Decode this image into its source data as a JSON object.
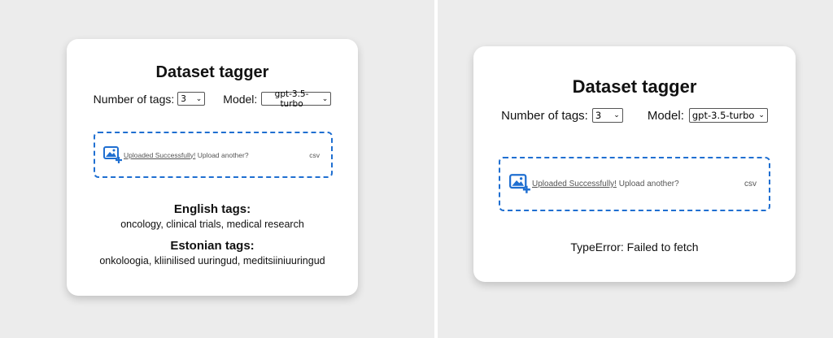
{
  "app": {
    "title": "Dataset tagger",
    "number_of_tags_label": "Number of tags:",
    "number_of_tags_value": "3",
    "model_label": "Model:",
    "model_value": "gpt-3.5-turbo",
    "upload": {
      "success_link": "Uploaded Successfully!",
      "again_text": " Upload another?",
      "file_type": "csv",
      "icon": "image-upload-icon"
    }
  },
  "left_result": {
    "english_heading": "English tags:",
    "english_tags": "oncology, clinical trials, medical research",
    "estonian_heading": "Estonian tags:",
    "estonian_tags": "onkoloogia, kliinilised uuringud, meditsiiniuuringud"
  },
  "right_result": {
    "error": "TypeError: Failed to fetch"
  },
  "colors": {
    "accent": "#1f6fd1",
    "panel_background": "#ececec",
    "card_background": "#ffffff"
  }
}
